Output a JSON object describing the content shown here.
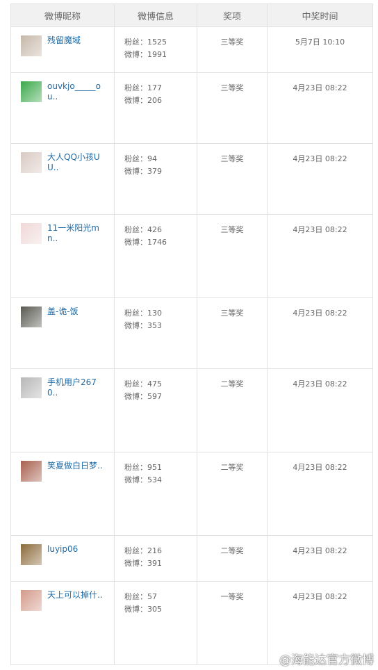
{
  "header": {
    "col_nick": "微博昵称",
    "col_info": "微博信息",
    "col_prize": "奖项",
    "col_time": "中奖时间"
  },
  "rows": [
    {
      "nick": "残留魔域",
      "fans": "粉丝：1525",
      "weibo": "微博：1991",
      "prize": "三等奖",
      "time": "5月7日 10:10",
      "avatar": "#c7b8a9"
    },
    {
      "nick": "ouvkjo_____ou..",
      "fans": "粉丝：177",
      "weibo": "微博：206",
      "prize": "三等奖",
      "time": "4月23日 08:22",
      "avatar": "#3aa84a"
    },
    {
      "nick": "大人QQ小孩UU..",
      "fans": "粉丝：94",
      "weibo": "微博：379",
      "prize": "三等奖",
      "time": "4月23日 08:22",
      "avatar": "#d9c9c2"
    },
    {
      "nick": "11一米阳光mn..",
      "fans": "粉丝：426",
      "weibo": "微博：1746",
      "prize": "三等奖",
      "time": "4月23日 08:22",
      "avatar": "#f0d8d8"
    },
    {
      "nick": "盖-诡-饭",
      "fans": "粉丝：130",
      "weibo": "微博：353",
      "prize": "三等奖",
      "time": "4月23日 08:22",
      "avatar": "#5a5a52"
    },
    {
      "nick": "手机用户2670..",
      "fans": "粉丝：475",
      "weibo": "微博：597",
      "prize": "二等奖",
      "time": "4月23日 08:22",
      "avatar": "#b7b7b7"
    },
    {
      "nick": "笑夏做白日梦..",
      "fans": "粉丝：951",
      "weibo": "微博：534",
      "prize": "二等奖",
      "time": "4月23日 08:22",
      "avatar": "#a8604e"
    },
    {
      "nick": "luyip06",
      "fans": "粉丝：216",
      "weibo": "微博：391",
      "prize": "二等奖",
      "time": "4月23日 08:22",
      "avatar": "#8c6a3a"
    },
    {
      "nick": "天上可以掉什..",
      "fans": "粉丝：57",
      "weibo": "微博：305",
      "prize": "一等奖",
      "time": "4月23日 08:22",
      "avatar": "#d49a8a"
    }
  ],
  "watermark": "@海能达官方微博"
}
